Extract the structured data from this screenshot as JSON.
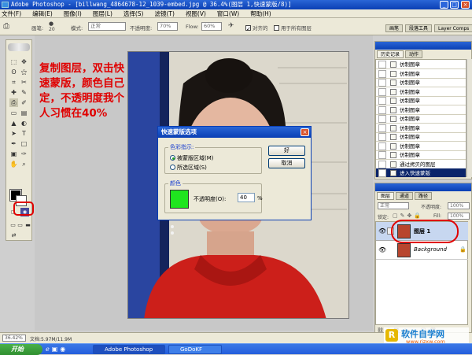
{
  "window": {
    "title": "Adobe Photoshop - [billwang_4864678-12_1039-embed.jpg @ 36.4%(图层 1,快速蒙版/8)]",
    "controls": {
      "minimize": "_",
      "restore": "□",
      "close": "×"
    }
  },
  "menubar": [
    "文件(F)",
    "编辑(E)",
    "图像(I)",
    "图层(L)",
    "选择(S)",
    "滤镜(T)",
    "视图(V)",
    "窗口(W)",
    "帮助(H)"
  ],
  "options": {
    "brush_label": "画笔:",
    "brush_size": "20",
    "mode_label": "模式:",
    "mode_value": "正常",
    "opacity_label": "不透明度:",
    "opacity_value": "70%",
    "flow_label": "Flow:",
    "flow_value": "60%",
    "aligned_label": "对齐的",
    "all_layers_label": "用于所有图层"
  },
  "palette_tabs": [
    "画笔",
    "段落工具",
    "Layer Comps"
  ],
  "annotation": "复制图层，双击快速蒙版，颜色自己定，不透明度我个人习惯在40%",
  "dialog": {
    "title": "快速蒙版选项",
    "color_indicates_label": "色彩指示:",
    "option_masked": "被蒙版区域(M)",
    "option_selected": "所选区域(S)",
    "color_group_label": "颜色",
    "opacity_label": "不透明度(O):",
    "opacity_value": "40",
    "percent": "%",
    "ok_label": "好",
    "cancel_label": "取消",
    "mask_color": "#1fe51f"
  },
  "history": {
    "tabs": [
      "历史记录",
      "动作"
    ],
    "items": [
      "仿制图章",
      "仿制图章",
      "仿制图章",
      "仿制图章",
      "仿制图章",
      "仿制图章",
      "仿制图章",
      "仿制图章",
      "仿制图章",
      "仿制图章",
      "仿制图章",
      "通过拷贝的图层",
      "进入快速蒙版"
    ]
  },
  "layers": {
    "tabs": [
      "图层",
      "通道",
      "路径"
    ],
    "blend_mode": "正常",
    "opacity_label": "不透明度:",
    "opacity_value": "100%",
    "lock_label": "锁定:",
    "fill_label": "Fill:",
    "fill_value": "100%",
    "items": [
      {
        "name": "图层 1",
        "selected": true
      },
      {
        "name": "Background",
        "italic": true
      }
    ]
  },
  "status": {
    "zoom": "36.42%",
    "doc_size": "文档:5.97M/11.9M"
  },
  "taskbar": {
    "start": "开始",
    "tasks": [
      "Adobe Photoshop",
      "GoDoKF"
    ],
    "clock": "23:45"
  },
  "watermark": {
    "text": "软件自学网",
    "url": "www.rjzxw.com"
  },
  "colors": {
    "accent_red": "#e00000",
    "titlebar_blue": "#0a3fb4",
    "mask_green": "#1fe51f"
  }
}
